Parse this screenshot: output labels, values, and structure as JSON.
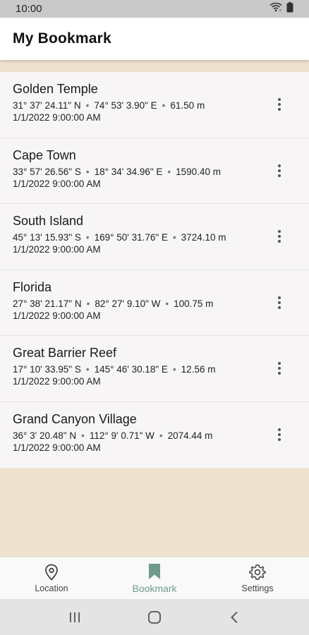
{
  "status_bar": {
    "time": "10:00",
    "icons": [
      "wifi-icon",
      "battery-icon"
    ]
  },
  "app_bar": {
    "title": "My Bookmark"
  },
  "bookmarks": [
    {
      "name": "Golden Temple",
      "lat": "31° 37' 24.11\" N",
      "lon": "74° 53' 3.90\" E",
      "alt": "61.50 m",
      "date": "1/1/2022 9:00:00 AM"
    },
    {
      "name": "Cape Town",
      "lat": "33° 57' 26.56\" S",
      "lon": "18° 34' 34.96\" E",
      "alt": "1590.40 m",
      "date": "1/1/2022 9:00:00 AM"
    },
    {
      "name": "South Island",
      "lat": "45° 13' 15.93\" S",
      "lon": "169° 50' 31.76\" E",
      "alt": "3724.10 m",
      "date": "1/1/2022 9:00:00 AM"
    },
    {
      "name": "Florida",
      "lat": "27° 38' 21.17\" N",
      "lon": "82° 27' 9.10\" W",
      "alt": "100.75 m",
      "date": "1/1/2022 9:00:00 AM"
    },
    {
      "name": "Great Barrier Reef",
      "lat": "17° 10' 33.95\" S",
      "lon": "145° 46' 30.18\" E",
      "alt": "12.56 m",
      "date": "1/1/2022 9:00:00 AM"
    },
    {
      "name": "Grand Canyon Village",
      "lat": "36° 3' 20.48\" N",
      "lon": "112° 9' 0.71\" W",
      "alt": "2074.44 m",
      "date": "1/1/2022 9:00:00 AM"
    }
  ],
  "bottom_nav": {
    "items": [
      {
        "label": "Location",
        "icon": "location-pin-icon"
      },
      {
        "label": "Bookmark",
        "icon": "bookmark-icon",
        "active": true
      },
      {
        "label": "Settings",
        "icon": "gear-icon"
      }
    ]
  },
  "colors": {
    "accent": "#6f9a8d",
    "background": "#efe3d0",
    "list_bg": "#f7f5f6"
  },
  "system_nav": [
    "recents-icon",
    "home-icon",
    "back-icon"
  ]
}
